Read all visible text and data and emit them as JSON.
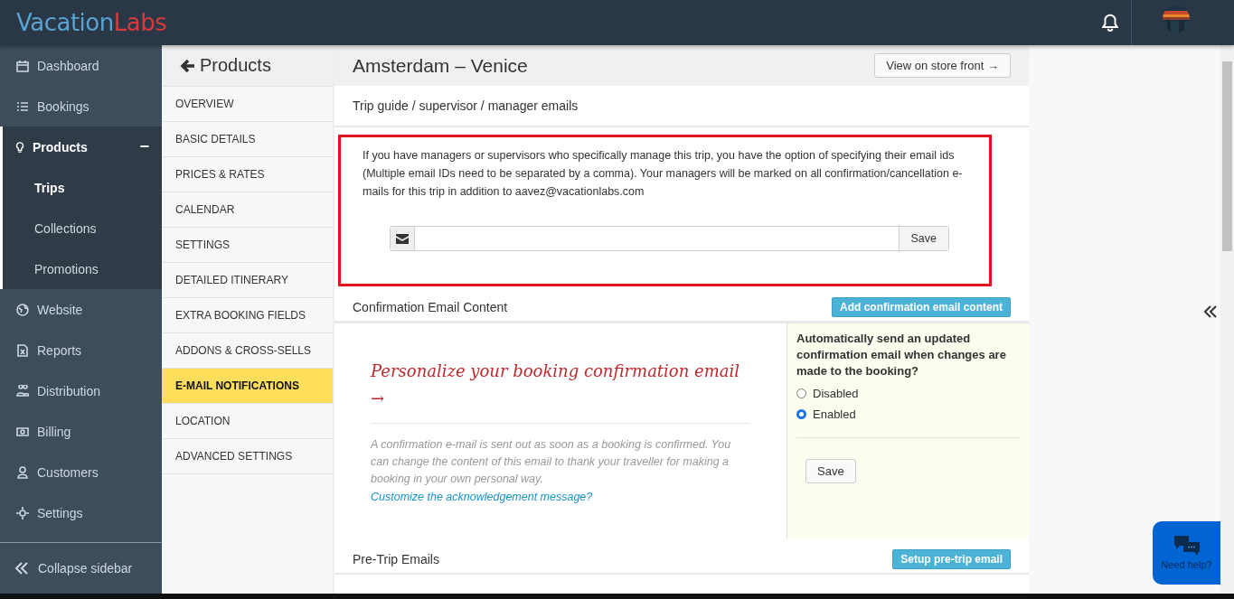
{
  "topbar": {
    "logo_first": "Vacation",
    "logo_second": "Labs"
  },
  "sidebar": {
    "items": [
      {
        "label": "Dashboard",
        "selected": false
      },
      {
        "label": "Bookings",
        "selected": false
      },
      {
        "label": "Products",
        "selected": true,
        "expanded": true,
        "toggle": "−",
        "children": [
          {
            "label": "Trips",
            "selected": true
          },
          {
            "label": "Collections",
            "selected": false
          },
          {
            "label": "Promotions",
            "selected": false
          }
        ]
      },
      {
        "label": "Website",
        "selected": false
      },
      {
        "label": "Reports",
        "selected": false
      },
      {
        "label": "Distribution",
        "selected": false
      },
      {
        "label": "Billing",
        "selected": false
      },
      {
        "label": "Customers",
        "selected": false
      },
      {
        "label": "Settings",
        "selected": false
      }
    ],
    "collapse": "Collapse sidebar"
  },
  "subnav": {
    "title": "Products",
    "items": [
      {
        "label": "OVERVIEW",
        "selected": false
      },
      {
        "label": "BASIC DETAILS",
        "selected": false
      },
      {
        "label": "PRICES & RATES",
        "selected": false
      },
      {
        "label": "CALENDAR",
        "selected": false
      },
      {
        "label": "SETTINGS",
        "selected": false
      },
      {
        "label": "DETAILED ITINERARY",
        "selected": false
      },
      {
        "label": "EXTRA BOOKING FIELDS",
        "selected": false
      },
      {
        "label": "ADDONS & CROSS-SELLS",
        "selected": false
      },
      {
        "label": "E-MAIL NOTIFICATIONS",
        "selected": true
      },
      {
        "label": "LOCATION",
        "selected": false
      },
      {
        "label": "ADVANCED SETTINGS",
        "selected": false
      }
    ]
  },
  "page": {
    "title": "Amsterdam – Venice",
    "store_button": "View on store front →"
  },
  "manager_emails": {
    "heading": "Trip guide / supervisor / manager emails",
    "highlighted": true,
    "description": "If you have managers or supervisors who specifically manage this trip, you have the option of specifying their email ids (Multiple email IDs need to be separated by a comma). Your managers will be marked on all confirmation/cancellation e-mails for this trip in addition to aavez@vacationlabs.com",
    "save_button": "Save"
  },
  "confirmation": {
    "heading": "Confirmation Email Content",
    "add_button": "Add confirmation email content",
    "promo_title": "Personalize your booking confirmation email →",
    "promo_text": "A confirmation e-mail is sent out as soon as a booking is confirmed. You can change the content of this email to thank your traveller for making a booking in your own personal way.",
    "link": "Customize the acknowledgement message?",
    "auto_question": "Automatically send an updated confirmation email when changes are made to the booking?",
    "options": [
      {
        "label": "Disabled",
        "selected": false
      },
      {
        "label": "Enabled",
        "selected": true
      }
    ],
    "save_button": "Save"
  },
  "pre_trip": {
    "heading": "Pre-Trip Emails",
    "button": "Setup pre-trip email"
  },
  "help_widget": {
    "label": "Need help?"
  }
}
